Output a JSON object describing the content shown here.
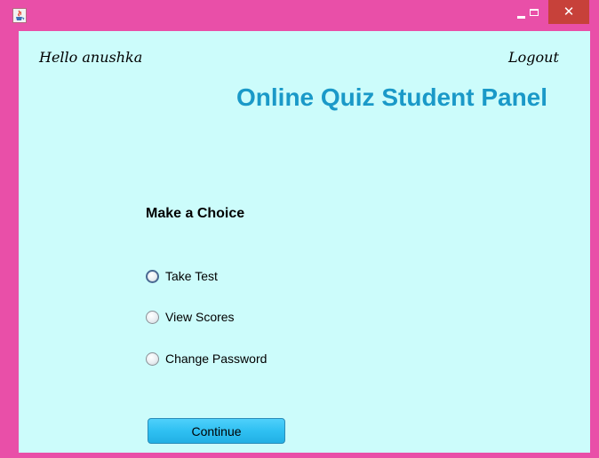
{
  "window": {
    "icon": "java-cup-icon",
    "minimize_glyph": "_",
    "maximize_glyph": "□",
    "close_glyph": "✕"
  },
  "header": {
    "greeting": "Hello anushka",
    "logout_label": "Logout",
    "title": "Online Quiz Student Panel"
  },
  "choice": {
    "heading": "Make a Choice",
    "options": [
      {
        "label": "Take Test",
        "selected": false,
        "focused": true
      },
      {
        "label": "View Scores",
        "selected": false,
        "focused": false
      },
      {
        "label": "Change Password",
        "selected": false,
        "focused": false
      }
    ],
    "continue_label": "Continue"
  },
  "colors": {
    "window_frame": "#e94fa8",
    "content_background": "#ccfcfb",
    "title_color": "#1a99c8",
    "close_button": "#c7413a",
    "button_blue": "#2fc0f2"
  }
}
